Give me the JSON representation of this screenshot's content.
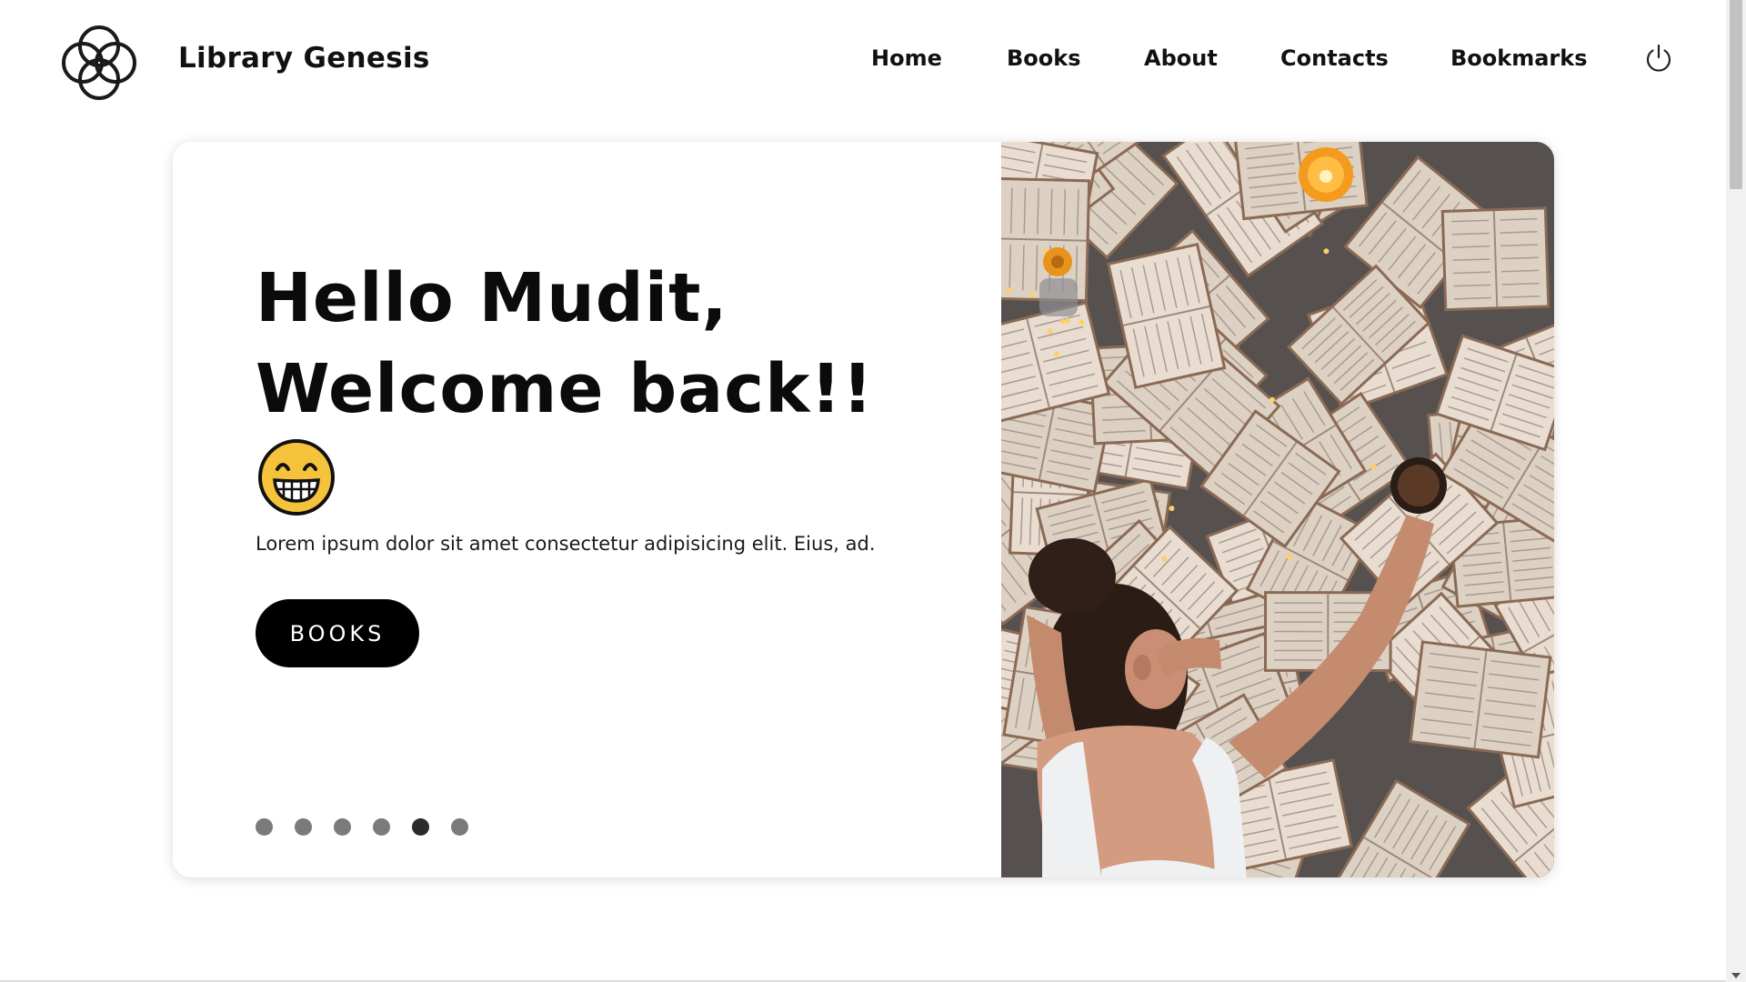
{
  "brand": {
    "name": "Library Genesis",
    "logo_icon": "four-rings-logo-icon"
  },
  "nav": {
    "items": [
      {
        "label": "Home"
      },
      {
        "label": "Books"
      },
      {
        "label": "About"
      },
      {
        "label": "Contacts"
      },
      {
        "label": "Bookmarks"
      }
    ],
    "power_icon": "power-icon"
  },
  "hero": {
    "greeting_line1": "Hello Mudit,",
    "greeting_line2": "Welcome back!!",
    "emoji_icon": "grinning-face-icon",
    "lead": "Lorem ipsum dolor sit amet consectetur adipisicing elit. Eius, ad.",
    "button_label": "BOOKS",
    "slides_total": 6,
    "active_slide": 5,
    "image_icon": "open-books-photo"
  },
  "colors": {
    "accent": "#000000",
    "emoji_yellow": "#f5c33b",
    "dot": "#7a7a7a",
    "dot_active": "#2b2b2b"
  }
}
